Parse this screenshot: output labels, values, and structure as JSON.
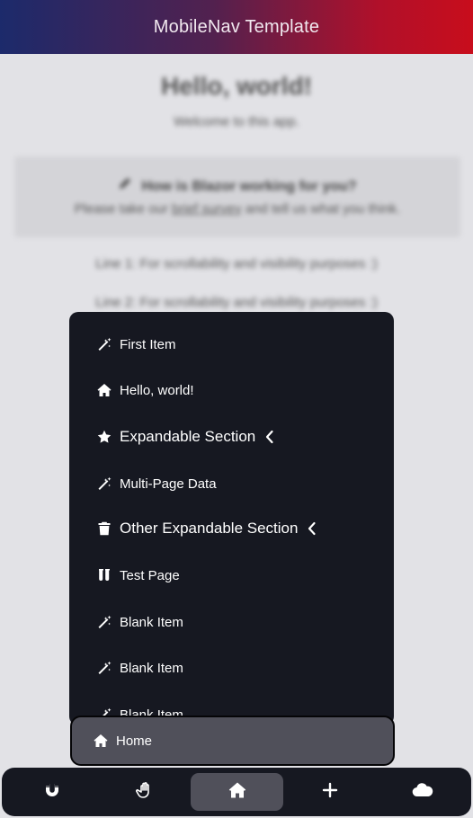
{
  "header": {
    "title": "MobileNav Template"
  },
  "content": {
    "heading": "Hello, world!",
    "welcome": "Welcome to this app.",
    "survey": {
      "question": "How is Blazor working for you?",
      "prefix": "Please take our",
      "link": "brief survey",
      "suffix": "and tell us what you think."
    },
    "lines": [
      "Line 1: For scrollability and visibility purposes :)",
      "Line 2: For scrollability and visibility purposes :)"
    ]
  },
  "drawer": {
    "items": [
      {
        "label": "First Item",
        "icon": "magic-wand-icon"
      },
      {
        "label": "Hello, world!",
        "icon": "home-icon"
      },
      {
        "label": "Expandable Section",
        "icon": "star-icon"
      },
      {
        "label": "Multi-Page Data",
        "icon": "magic-wand-icon"
      },
      {
        "label": "Other Expandable Section",
        "icon": "trash-icon"
      },
      {
        "label": "Test Page",
        "icon": "test-tubes-icon"
      },
      {
        "label": "Blank Item",
        "icon": "magic-wand-icon"
      },
      {
        "label": "Blank Item",
        "icon": "magic-wand-icon"
      },
      {
        "label": "Blank Item",
        "icon": "magic-wand-icon"
      }
    ],
    "current": {
      "label": "Home",
      "icon": "home-icon"
    }
  },
  "bottom_nav": {
    "tabs": [
      {
        "icon": "magnet-icon"
      },
      {
        "icon": "hand-icon"
      },
      {
        "icon": "home-icon",
        "active": true
      },
      {
        "icon": "plus-icon"
      },
      {
        "icon": "cloud-icon"
      }
    ]
  }
}
